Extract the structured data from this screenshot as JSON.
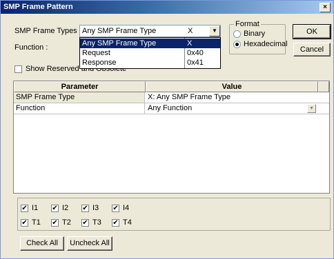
{
  "window": {
    "title": "SMP Frame Pattern",
    "close_glyph": "×"
  },
  "form": {
    "frame_types_label": "SMP Frame Types :",
    "function_label": "Function :",
    "combo_value": "Any SMP Frame Type",
    "combo_code": "X",
    "dropdown_options": [
      {
        "text": "Any SMP Frame Type",
        "code": "X",
        "selected": true
      },
      {
        "text": "Request",
        "code": "0x40",
        "selected": false
      },
      {
        "text": "Response",
        "code": "0x41",
        "selected": false
      }
    ],
    "show_reserved_label": "Show Reserved and Obsolete",
    "show_reserved_checked": false
  },
  "format": {
    "title": "Format",
    "options": [
      {
        "label": "Binary",
        "selected": false
      },
      {
        "label": "Hexadecimal",
        "selected": true
      }
    ]
  },
  "buttons": {
    "ok": "OK",
    "cancel": "Cancel",
    "check_all": "Check All",
    "uncheck_all": "Uncheck All"
  },
  "grid": {
    "headers": [
      "Parameter",
      "Value"
    ],
    "rows": [
      {
        "param": "SMP Frame Type",
        "value": "X: Any SMP Frame Type",
        "has_dropdown": false
      },
      {
        "param": "Function",
        "value": "Any Function",
        "has_dropdown": true
      }
    ]
  },
  "checkboxes": [
    {
      "label": "I1",
      "checked": true
    },
    {
      "label": "I2",
      "checked": true
    },
    {
      "label": "I3",
      "checked": true
    },
    {
      "label": "I4",
      "checked": true
    },
    {
      "label": "T1",
      "checked": true
    },
    {
      "label": "T2",
      "checked": true
    },
    {
      "label": "T3",
      "checked": true
    },
    {
      "label": "T4",
      "checked": true
    }
  ],
  "glyphs": {
    "check": "✔",
    "dropdown_arrow": "▼"
  }
}
